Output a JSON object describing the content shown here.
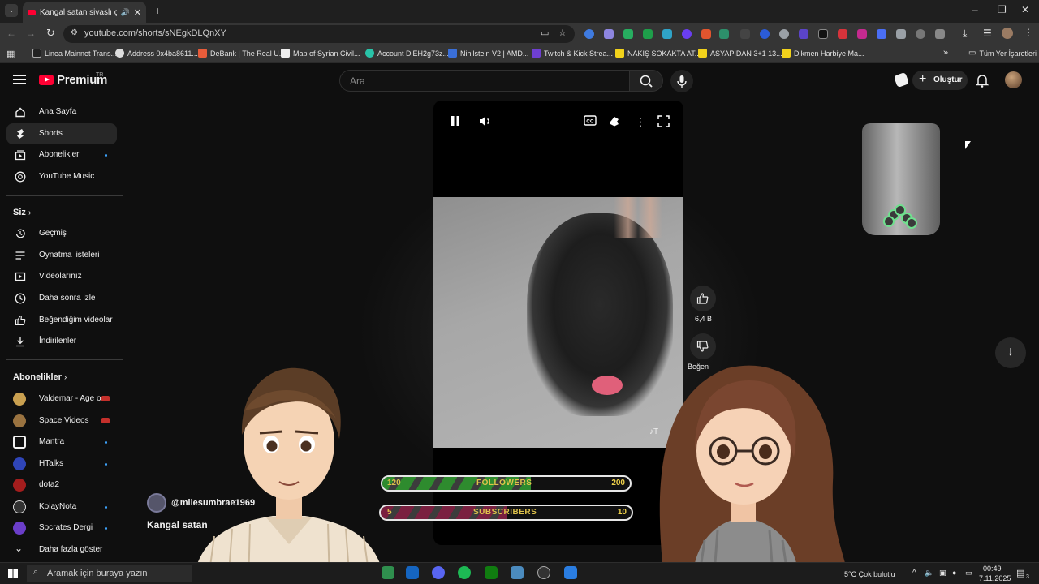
{
  "browser": {
    "tab_title": "Kangal satan sivaslı çocukla",
    "url": "youtube.com/shorts/sNEgkDLQnXY",
    "bookmarks": [
      "Linea Mainnet Trans...",
      "Address 0x4ba8611...",
      "DeBank | The Real U...",
      "Map of Syrian Civil...",
      "Account DiEH2g73z...",
      "Nihilstein V2 | AMD...",
      "Twitch & Kick Strea...",
      "NAKIŞ SOKAKTA AT...",
      "ASYAPIDAN 3+1 13...",
      "Dikmen Harbiye Ma..."
    ],
    "all_bookmarks": "Tüm Yer İşaretleri"
  },
  "youtube": {
    "brand": "Premium",
    "region": "TR",
    "search_placeholder": "Ara",
    "create_label": "Oluştur"
  },
  "sidebar": {
    "main": [
      "Ana Sayfa",
      "Shorts",
      "Abonelikler",
      "YouTube Music"
    ],
    "you_heading": "Siz",
    "you_items": [
      "Geçmiş",
      "Oynatma listeleri",
      "Videolarınız",
      "Daha sonra izle",
      "Beğendiğim videolar",
      "İndirilenler"
    ],
    "subs_heading": "Abonelikler",
    "subscriptions": [
      "Valdemar - Age o...",
      "Space Videos",
      "Mantra",
      "HTalks",
      "dota2",
      "KolayNota",
      "Socrates Dergi"
    ],
    "show_more": "Daha fazla göster"
  },
  "short": {
    "like_count": "6,4 B",
    "dislike_label": "Beğen",
    "channel": "@milesumbrae1969",
    "title": "Kangal satan"
  },
  "overlays": {
    "followers": {
      "label": "FOLLOWERS",
      "current": "120",
      "goal": "200",
      "fill": 0.6,
      "color": "#2e8b2e"
    },
    "subscribers": {
      "label": "SUBSCRIBERS",
      "current": "5",
      "goal": "10",
      "fill": 0.5,
      "color": "#7a2040"
    }
  },
  "taskbar": {
    "search_placeholder": "Aramak için buraya yazın",
    "weather": "5°C  Çok bulutlu",
    "time": "00:49",
    "date": "7.11.2025",
    "notif_count": "3"
  }
}
